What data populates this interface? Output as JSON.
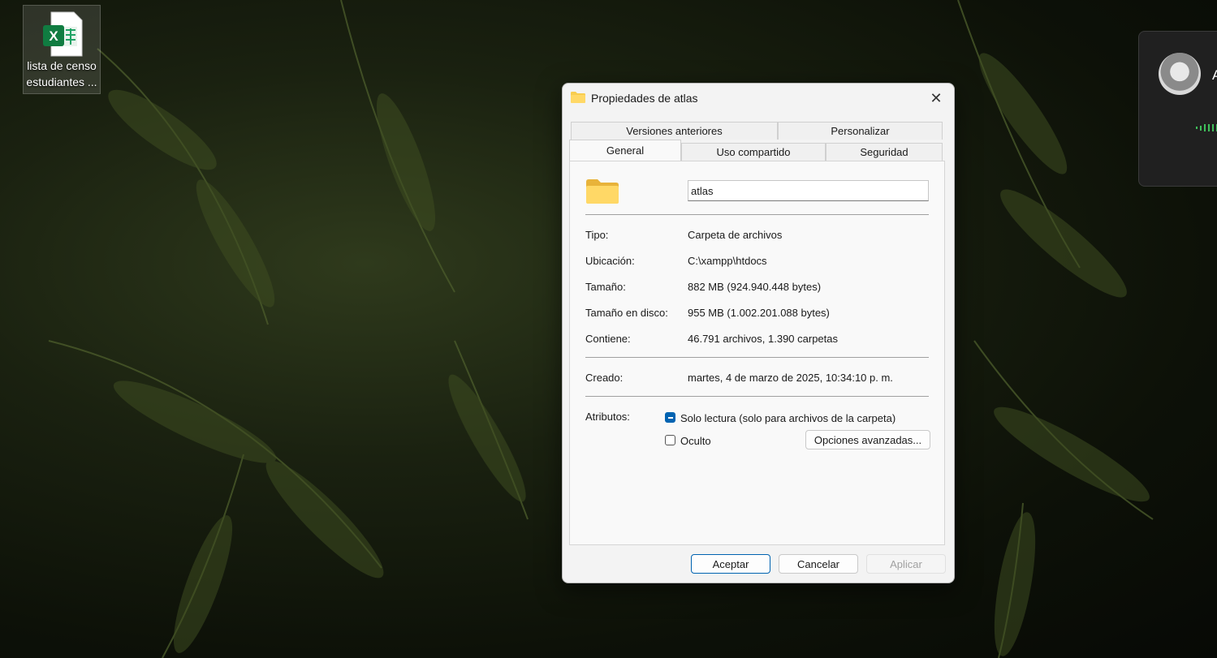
{
  "desktop": {
    "icon_label": "lista de censo estudiantes ...",
    "icon_type": "excel-file-icon"
  },
  "notification": {
    "initial": "A"
  },
  "dialog": {
    "title": "Propiedades de atlas",
    "tabs": {
      "previous_versions": "Versiones anteriores",
      "customize": "Personalizar",
      "general": "General",
      "sharing": "Uso compartido",
      "security": "Seguridad"
    },
    "folder_name": "atlas",
    "rows": {
      "type_label": "Tipo:",
      "type_value": "Carpeta de archivos",
      "location_label": "Ubicación:",
      "location_value": "C:\\xampp\\htdocs",
      "size_label": "Tamaño:",
      "size_value": "882 MB (924.940.448 bytes)",
      "disk_size_label": "Tamaño en disco:",
      "disk_size_value": "955 MB (1.002.201.088 bytes)",
      "contains_label": "Contiene:",
      "contains_value": "46.791 archivos, 1.390 carpetas",
      "created_label": "Creado:",
      "created_value": "martes, 4 de marzo de 2025, 10:34:10 p. m."
    },
    "attributes": {
      "label": "Atributos:",
      "readonly_label": "Solo lectura (solo para archivos de la carpeta)",
      "readonly_state": "indeterminate",
      "hidden_label": "Oculto",
      "hidden_state": "unchecked",
      "advanced_button": "Opciones avanzadas..."
    },
    "buttons": {
      "ok": "Aceptar",
      "cancel": "Cancelar",
      "apply": "Aplicar"
    },
    "colors": {
      "accent": "#0063b1",
      "folder": "#f8cd4f"
    }
  }
}
